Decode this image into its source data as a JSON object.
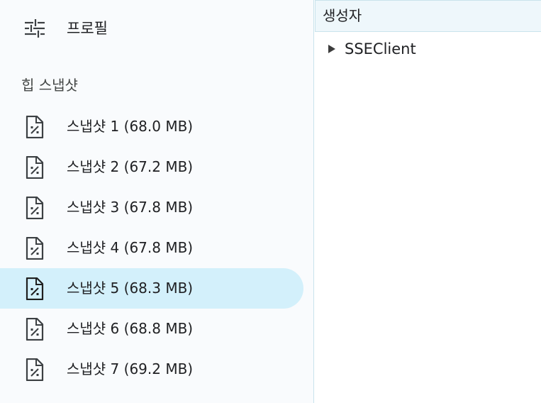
{
  "sidebar": {
    "profiles_label": "프로필",
    "section_title": "힙 스냅샷",
    "snapshots": [
      {
        "label": "스냅샷 1 (68.0 MB)"
      },
      {
        "label": "스냅샷 2 (67.2 MB)"
      },
      {
        "label": "스냅샷 3 (67.8 MB)"
      },
      {
        "label": "스냅샷 4 (67.8 MB)"
      },
      {
        "label": "스냅샷 5 (68.3 MB)"
      },
      {
        "label": "스냅샷 6 (68.8 MB)"
      },
      {
        "label": "스냅샷 7 (69.2 MB)"
      }
    ],
    "selected_snapshot": "스냅샷 5 (68.3 MB)"
  },
  "panel": {
    "column_header": "생성자",
    "rows": [
      {
        "label": "SSEClient",
        "expanded": false
      }
    ]
  },
  "icons": {
    "profiles": "sliders-icon",
    "snapshot": "heap-snapshot-file-icon",
    "expand": "triangle-right-icon"
  },
  "colors": {
    "selected_background": "#d3f0fb",
    "header_background": "#eef7fb",
    "border": "#c9e3ec"
  }
}
